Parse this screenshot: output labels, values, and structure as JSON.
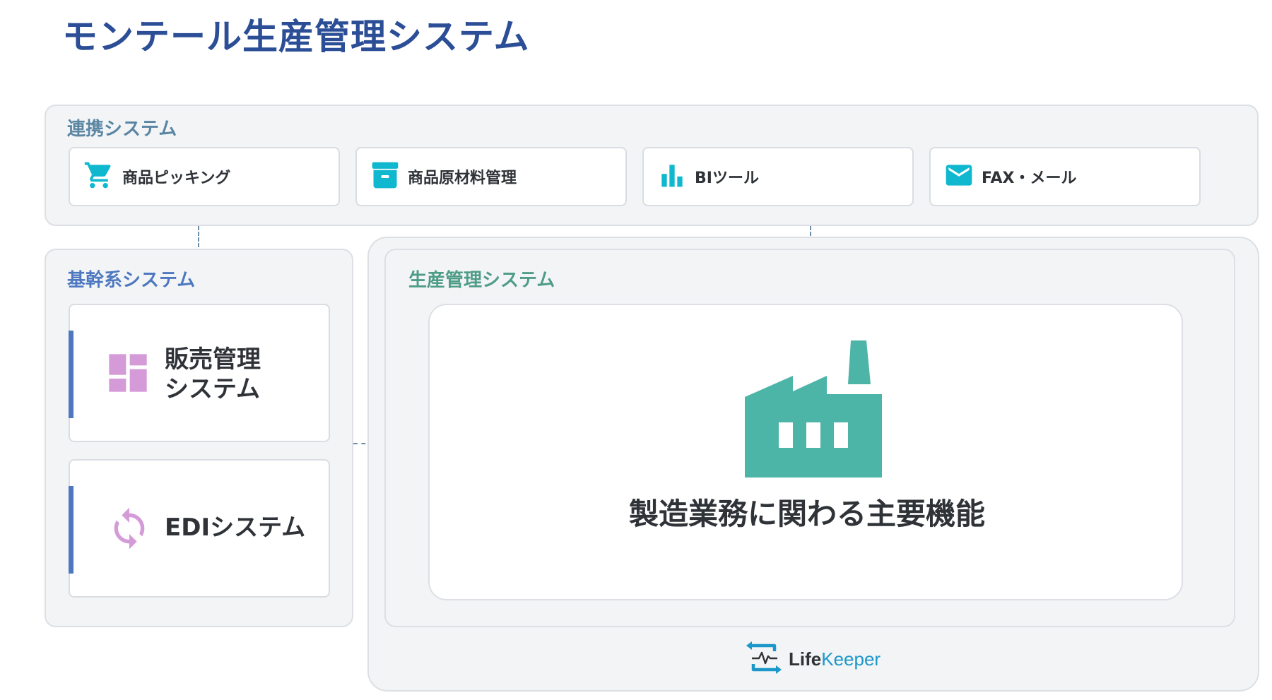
{
  "page": {
    "title": "モンテール生産管理システム"
  },
  "colors": {
    "title": "#2b4e96",
    "linked_title": "#5a86a3",
    "core_title": "#4d78c0",
    "production_title": "#4f9d86",
    "link_icon": "#0fb8cf",
    "core_icon": "#d59ad8",
    "factory": "#4db4a8",
    "accent_bar": "#4d78c0",
    "connector": "#6f8fa8"
  },
  "linked_systems": {
    "title": "連携システム",
    "items": [
      {
        "label": "商品ピッキング",
        "icon": "cart-icon"
      },
      {
        "label": "商品原材料管理",
        "icon": "archive-box-icon"
      },
      {
        "label": "BIツール",
        "icon": "bar-chart-icon"
      },
      {
        "label": "FAX・メール",
        "icon": "mail-icon"
      }
    ]
  },
  "core_systems": {
    "title": "基幹系システム",
    "items": [
      {
        "line1": "販売管理",
        "line2": "システム",
        "icon": "dashboard-grid-icon"
      },
      {
        "label": "EDIシステム",
        "icon": "sync-arrows-icon"
      }
    ]
  },
  "production": {
    "title": "生産管理システム",
    "main_label": "製造業務に関わる主要機能",
    "icon": "factory-icon"
  },
  "logo": {
    "text_life": "Life",
    "text_keeper": "Keeper",
    "icon": "lifekeeper-logo-icon"
  }
}
